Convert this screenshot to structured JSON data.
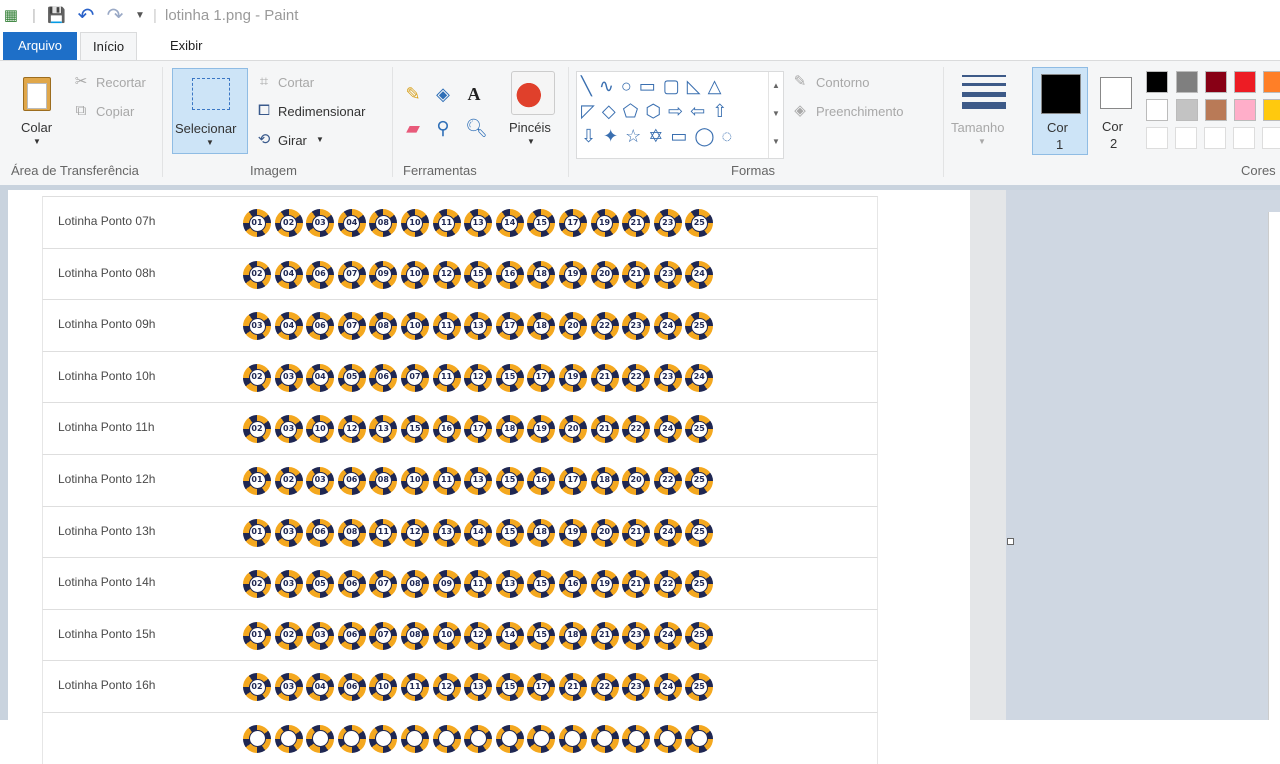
{
  "window": {
    "title": "lotinha 1.png - Paint"
  },
  "tabs": [
    {
      "label": "Arquivo"
    },
    {
      "label": "Início"
    },
    {
      "label": "Exibir"
    }
  ],
  "ribbon": {
    "clipboard": {
      "label": "Área de Transferência",
      "paste": "Colar",
      "cut": "Recortar",
      "copy": "Copiar"
    },
    "image": {
      "label": "Imagem",
      "select": "Selecionar",
      "crop": "Cortar",
      "resize": "Redimensionar",
      "rotate": "Girar"
    },
    "tools": {
      "label": "Ferramentas"
    },
    "brushes": {
      "label": "Pincéis"
    },
    "shapes": {
      "label": "Formas",
      "outline": "Contorno",
      "fill": "Preenchimento"
    },
    "size": {
      "label": "Tamanho"
    },
    "color1": {
      "label": "Cor\n1",
      "line1": "Cor",
      "line2": "1",
      "value": "#000000"
    },
    "color2": {
      "label": "Cor 2",
      "line1": "Cor",
      "line2": "2",
      "value": "#ffffff"
    },
    "colors": {
      "label": "Cores"
    },
    "palette": [
      "#000000",
      "#7f7f7f",
      "#880015",
      "#ed1c24",
      "#ff7f27",
      "#ffffff",
      "#c3c3c3",
      "#b97a57",
      "#ffaec9",
      "#ffc90e"
    ]
  },
  "colors": {
    "accent": "#1e6fc8",
    "ball_gold": "#f4a81f",
    "ball_navy": "#1f2752"
  },
  "rows": [
    {
      "label": "Lotinha Ponto 07h",
      "numbers": [
        "01",
        "02",
        "03",
        "04",
        "08",
        "10",
        "11",
        "13",
        "14",
        "15",
        "17",
        "19",
        "21",
        "23",
        "25"
      ]
    },
    {
      "label": "Lotinha Ponto 08h",
      "numbers": [
        "02",
        "04",
        "06",
        "07",
        "09",
        "10",
        "12",
        "15",
        "16",
        "18",
        "19",
        "20",
        "21",
        "23",
        "24"
      ]
    },
    {
      "label": "Lotinha Ponto 09h",
      "numbers": [
        "03",
        "04",
        "06",
        "07",
        "08",
        "10",
        "11",
        "13",
        "17",
        "18",
        "20",
        "22",
        "23",
        "24",
        "25"
      ]
    },
    {
      "label": "Lotinha Ponto 10h",
      "numbers": [
        "02",
        "03",
        "04",
        "05",
        "06",
        "07",
        "11",
        "12",
        "15",
        "17",
        "19",
        "21",
        "22",
        "23",
        "24"
      ]
    },
    {
      "label": "Lotinha Ponto 11h",
      "numbers": [
        "02",
        "03",
        "10",
        "12",
        "13",
        "15",
        "16",
        "17",
        "18",
        "19",
        "20",
        "21",
        "22",
        "24",
        "25"
      ]
    },
    {
      "label": "Lotinha Ponto 12h",
      "numbers": [
        "01",
        "02",
        "03",
        "06",
        "08",
        "10",
        "11",
        "13",
        "15",
        "16",
        "17",
        "18",
        "20",
        "22",
        "25"
      ]
    },
    {
      "label": "Lotinha Ponto 13h",
      "numbers": [
        "01",
        "03",
        "06",
        "08",
        "11",
        "12",
        "13",
        "14",
        "15",
        "18",
        "19",
        "20",
        "21",
        "24",
        "25"
      ]
    },
    {
      "label": "Lotinha Ponto 14h",
      "numbers": [
        "02",
        "03",
        "05",
        "06",
        "07",
        "08",
        "09",
        "11",
        "13",
        "15",
        "16",
        "19",
        "21",
        "22",
        "25"
      ]
    },
    {
      "label": "Lotinha Ponto 15h",
      "numbers": [
        "01",
        "02",
        "03",
        "06",
        "07",
        "08",
        "10",
        "12",
        "14",
        "15",
        "18",
        "21",
        "23",
        "24",
        "25"
      ]
    },
    {
      "label": "Lotinha Ponto 16h",
      "numbers": [
        "02",
        "03",
        "04",
        "06",
        "10",
        "11",
        "12",
        "13",
        "15",
        "17",
        "21",
        "22",
        "23",
        "24",
        "25"
      ]
    },
    {
      "label": "",
      "numbers": [
        "",
        "",
        "",
        "",
        "",
        "",
        "",
        "",
        "",
        "",
        "",
        "",
        "",
        "",
        ""
      ]
    }
  ]
}
